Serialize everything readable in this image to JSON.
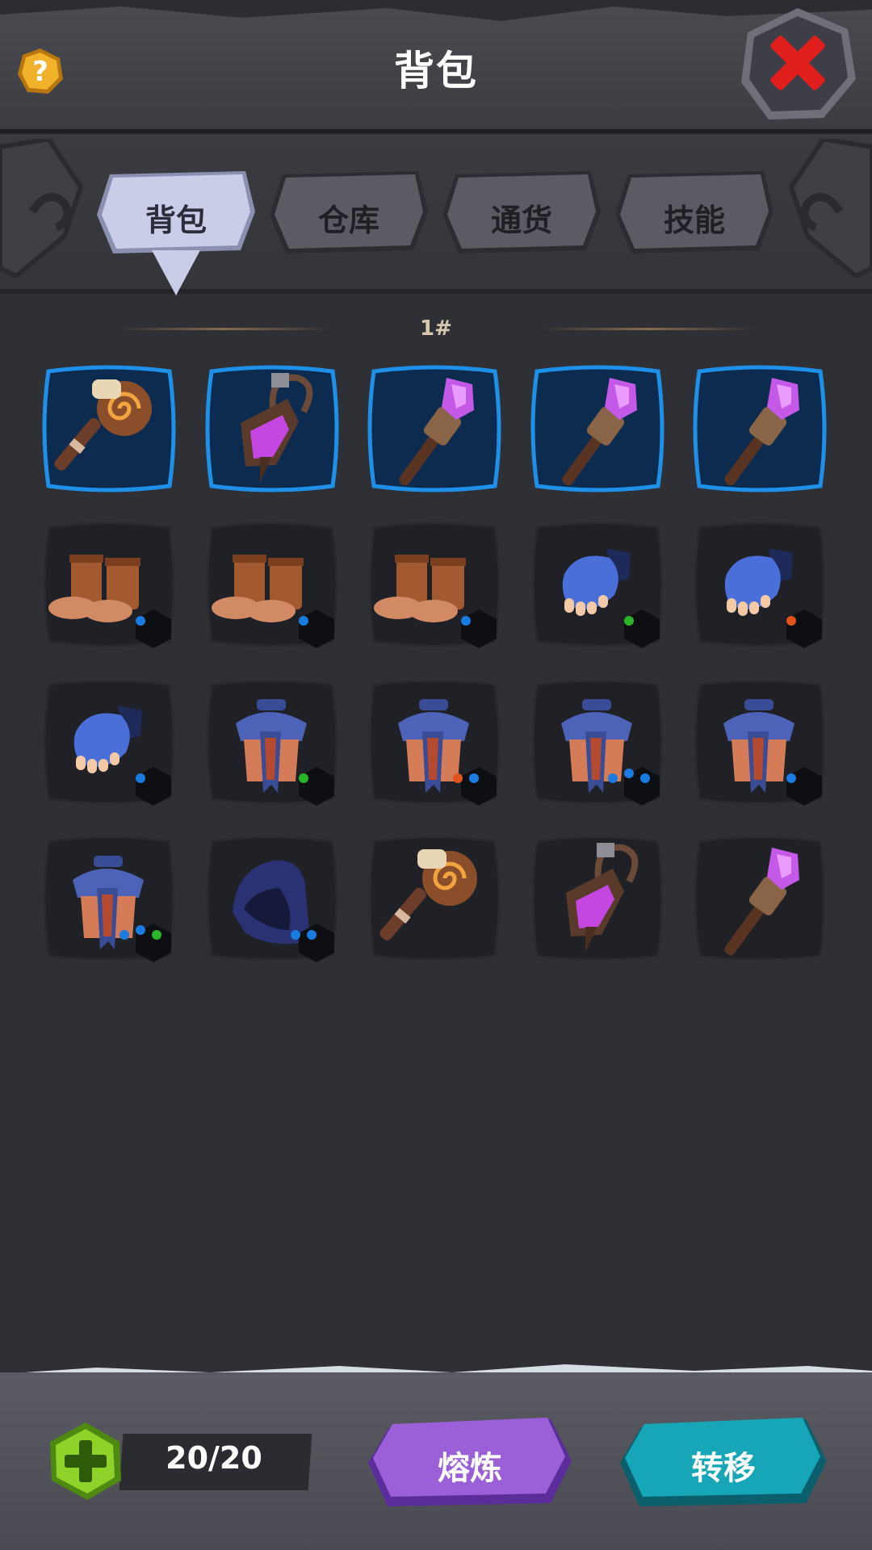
{
  "header": {
    "title": "背包",
    "help_icon": "question-icon",
    "close_icon": "close-x-icon"
  },
  "tabs": [
    {
      "label": "背包",
      "active": true
    },
    {
      "label": "仓库",
      "active": false
    },
    {
      "label": "通货",
      "active": false
    },
    {
      "label": "技能",
      "active": false
    }
  ],
  "page_label": "1#",
  "grid": [
    [
      {
        "item": "swirl-staff",
        "equipped": true
      },
      {
        "item": "lantern",
        "equipped": true
      },
      {
        "item": "crystal-staff",
        "equipped": true
      },
      {
        "item": "crystal-staff",
        "equipped": true
      },
      {
        "item": "crystal-staff",
        "equipped": true
      }
    ],
    [
      {
        "item": "boots",
        "gems": [
          "#1a7be0"
        ]
      },
      {
        "item": "boots",
        "gems": [
          "#1a7be0"
        ]
      },
      {
        "item": "boots",
        "gems": [
          "#1a7be0"
        ]
      },
      {
        "item": "glove",
        "gems": [
          "#2bb52b"
        ]
      },
      {
        "item": "glove",
        "gems": [
          "#e0541a"
        ]
      }
    ],
    [
      {
        "item": "glove",
        "gems": [
          "#1a7be0"
        ]
      },
      {
        "item": "robe",
        "gems": [
          "#2bb52b"
        ]
      },
      {
        "item": "robe",
        "gems": [
          "#e0541a",
          "#1a7be0"
        ]
      },
      {
        "item": "robe",
        "gems": [
          "#1a7be0",
          "#1a7be0",
          "#1a7be0"
        ]
      },
      {
        "item": "robe",
        "gems": [
          "#1a7be0"
        ]
      }
    ],
    [
      {
        "item": "robe",
        "gems": [
          "#1a7be0",
          "#1a7be0",
          "#2bb52b"
        ]
      },
      {
        "item": "hood",
        "gems": [
          "#1a7be0",
          "#1a7be0"
        ]
      },
      {
        "item": "swirl-staff"
      },
      {
        "item": "lantern"
      },
      {
        "item": "crystal-staff"
      }
    ]
  ],
  "footer": {
    "capacity": "20/20",
    "smelt_label": "熔炼",
    "transfer_label": "转移",
    "add_icon": "plus-icon"
  },
  "colors": {
    "smelt": "#9b5fd8",
    "transfer": "#17a6b8",
    "equipped_border": "#1e90e8"
  }
}
